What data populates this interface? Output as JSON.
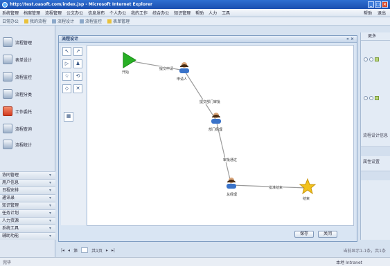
{
  "window": {
    "title": "http://test.oasoft.com/index.jsp - Microsoft Internet Explorer"
  },
  "menubar": {
    "items": [
      "系统管理",
      "档案管理",
      "流程管理",
      "公文办公",
      "信息发布",
      "个人办公",
      "我的工作",
      "综合办公",
      "知识管理",
      "帮助",
      "人力",
      "工具"
    ],
    "right": [
      "帮助",
      "退出"
    ]
  },
  "toolbar": {
    "items": [
      "日常办公",
      "我的流程",
      "流程设计",
      "流程监控",
      "表单管理"
    ]
  },
  "sidebar": {
    "items": [
      "流程管理",
      "表单设计",
      "流程监控",
      "流程分类",
      "工作委托",
      "流程查询",
      "流程统计"
    ],
    "lists": [
      "协同管理",
      "用户信息",
      "日程安排",
      "通讯录",
      "知识管理",
      "任务计划",
      "人力资源",
      "系统工具",
      "辅助功能"
    ]
  },
  "panel": {
    "title": "流程设计",
    "controls": "« ×",
    "buttons": {
      "save": "保存",
      "close": "关闭"
    }
  },
  "tools": [
    "select-tool",
    "connect-tool",
    "start-node-tool",
    "task-node-tool",
    "end-node-tool",
    "fork-node-tool",
    "decision-tool",
    "delete-tool",
    "grid-tool"
  ],
  "workflow": {
    "nodes": [
      {
        "id": "start",
        "label": "开始",
        "type": "start"
      },
      {
        "id": "n1",
        "label": "申请人",
        "type": "task"
      },
      {
        "id": "n2",
        "label": "部门经理",
        "type": "task"
      },
      {
        "id": "n3",
        "label": "总经理",
        "type": "task"
      },
      {
        "id": "end",
        "label": "结束",
        "type": "end"
      }
    ],
    "edges": [
      {
        "from": "start",
        "to": "n1",
        "label": "提交申请"
      },
      {
        "from": "n1",
        "to": "n2",
        "label": "提交部门审批"
      },
      {
        "from": "n2",
        "to": "n3",
        "label": "审批通过"
      },
      {
        "from": "n3",
        "to": "end",
        "label": "批准结束"
      }
    ],
    "colors": {
      "start": "#27b024",
      "end": "#f2c21c",
      "task": "#3a73c9",
      "edge": "#9a9a9a"
    }
  },
  "rightpanel": {
    "header": "更多",
    "text1": "流程设计信息",
    "text2": "属性设置"
  },
  "pager": {
    "page_label": "第",
    "page_value": "1",
    "total": "共1页",
    "info": "当前显示1-1条，共1条"
  },
  "statusbar": {
    "left": "完毕",
    "right": "本地 Intranet"
  }
}
